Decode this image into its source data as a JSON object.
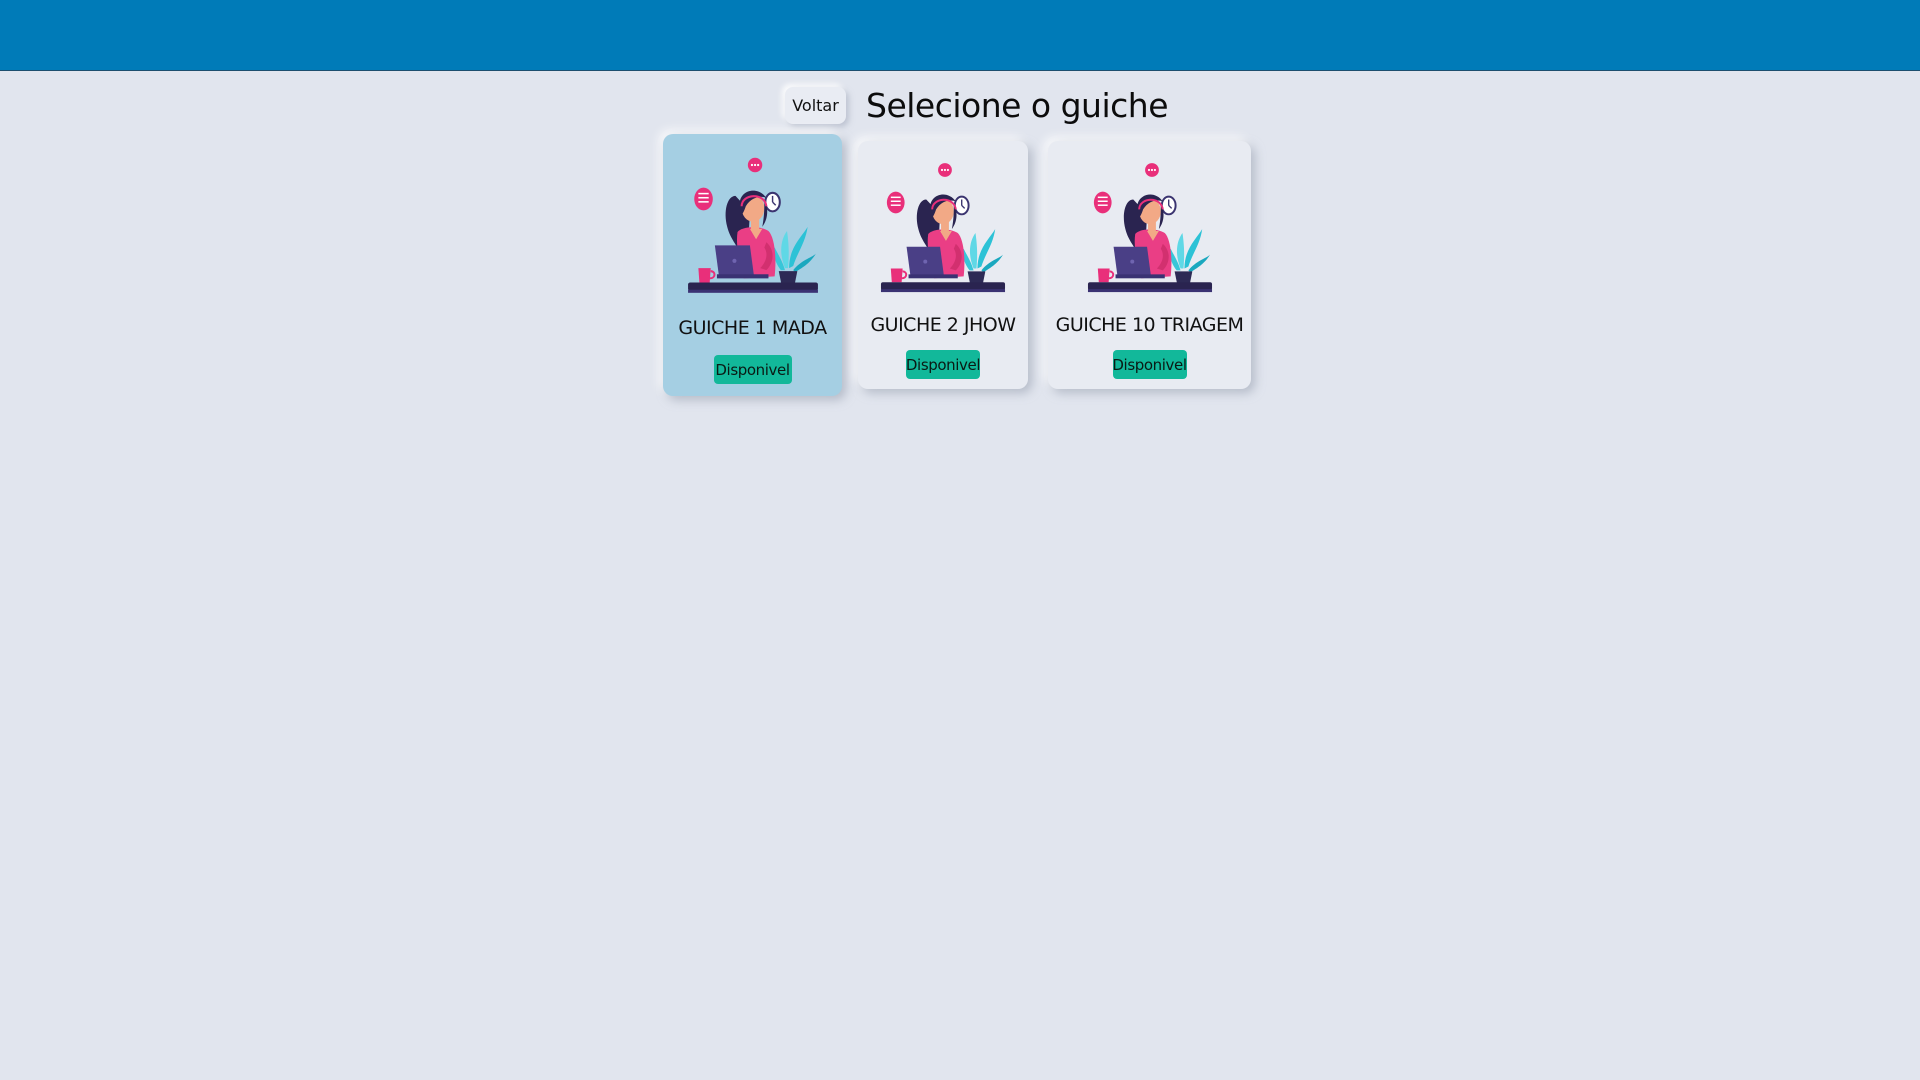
{
  "header": {
    "back_label": "Voltar",
    "title": "Selecione o guiche"
  },
  "guiches": [
    {
      "name": "GUICHE 1 MADA",
      "status": "Disponivel",
      "selected": true
    },
    {
      "name": "GUICHE 2 JHOW",
      "status": "Disponivel",
      "selected": false
    },
    {
      "name": "GUICHE 10 TRIAGEM",
      "status": "Disponivel",
      "selected": false
    }
  ],
  "colors": {
    "topbar": "#007bb8",
    "background": "#e1e5ee",
    "selected_card": "#a5cfe3",
    "status_badge": "#12b89a"
  },
  "icons": {
    "card_illustration": "attendant-at-laptop-illustration"
  }
}
